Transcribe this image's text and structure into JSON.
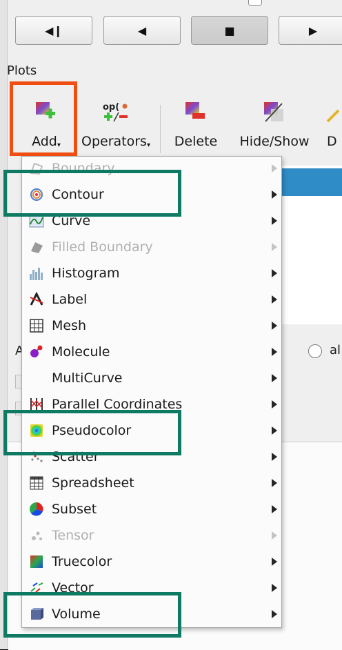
{
  "animation_controls": {
    "step_back": "◀❙",
    "reverse_play": "◀",
    "stop": "■",
    "play": "▶"
  },
  "plots_section": {
    "title": "Plots",
    "toolbar": {
      "add_label": "Add",
      "operators_icon_text": "op(",
      "operators_label": "Operators",
      "delete_label": "Delete",
      "hide_show_label": "Hide/Show",
      "draw_label_partial": "D"
    }
  },
  "background_panel": {
    "partial_label_a": "A",
    "radio_label_partial": "al"
  },
  "add_menu": {
    "items": [
      {
        "label": "Boundary",
        "icon": "boundary-icon",
        "enabled": false
      },
      {
        "label": "Contour",
        "icon": "contour-icon",
        "enabled": true
      },
      {
        "label": "Curve",
        "icon": "curve-icon",
        "enabled": true
      },
      {
        "label": "Filled Boundary",
        "icon": "filled-boundary-icon",
        "enabled": false
      },
      {
        "label": "Histogram",
        "icon": "histogram-icon",
        "enabled": true
      },
      {
        "label": "Label",
        "icon": "label-icon",
        "enabled": true
      },
      {
        "label": "Mesh",
        "icon": "mesh-icon",
        "enabled": true
      },
      {
        "label": "Molecule",
        "icon": "molecule-icon",
        "enabled": true
      },
      {
        "label": "MultiCurve",
        "icon": "",
        "enabled": true
      },
      {
        "label": "Parallel Coordinates",
        "icon": "parallel-coordinates-icon",
        "enabled": true
      },
      {
        "label": "Pseudocolor",
        "icon": "pseudocolor-icon",
        "enabled": true
      },
      {
        "label": "Scatter",
        "icon": "scatter-icon",
        "enabled": true
      },
      {
        "label": "Spreadsheet",
        "icon": "spreadsheet-icon",
        "enabled": true
      },
      {
        "label": "Subset",
        "icon": "subset-icon",
        "enabled": true
      },
      {
        "label": "Tensor",
        "icon": "tensor-icon",
        "enabled": false
      },
      {
        "label": "Truecolor",
        "icon": "truecolor-icon",
        "enabled": true
      },
      {
        "label": "Vector",
        "icon": "vector-icon",
        "enabled": true
      },
      {
        "label": "Volume",
        "icon": "volume-icon",
        "enabled": true
      }
    ]
  },
  "annotation_colors": {
    "add_highlight": "#f04e12",
    "item_highlight": "#0e7a63",
    "selection": "#308cc6"
  }
}
